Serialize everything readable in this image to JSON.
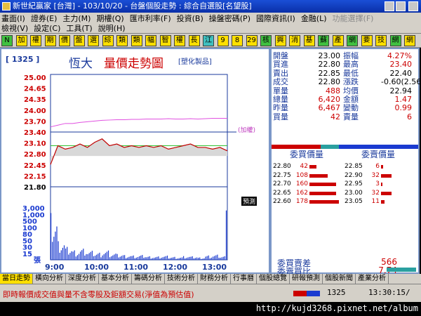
{
  "titlebar": {
    "text": "新世紀贏家 [台灣] - 103/10/20 - 台盤個股走勢 : 綜合自選股[名望股]"
  },
  "menu": {
    "row1": [
      "畫面(I)",
      "證券(E)",
      "主力(M)",
      "期權(Q)",
      "匯市利率(F)",
      "投資(B)",
      "操盤密碼(P)",
      "國際資訊(I)",
      "金融(L)",
      "功能選擇(F)"
    ],
    "row1_dim": [
      "功能選擇(F)"
    ],
    "row2": [
      "檢視(V)",
      "設定(C)",
      "工具(T)",
      "說明(H)"
    ]
  },
  "toolbar": {
    "buttons": [
      "N",
      "加",
      "權",
      "期",
      "價",
      "盤",
      "選",
      "綜",
      "類",
      "類",
      "幅",
      "智",
      "權",
      "長",
      "江",
      "9",
      "8",
      "29",
      "核",
      "興",
      "消",
      "基",
      "蘇",
      "產",
      "網",
      "要",
      "技",
      "網",
      "網"
    ]
  },
  "chart": {
    "code": "[ 1325 ]",
    "stock_name": "恆大",
    "title": "量價走勢圖",
    "industry": "[塑化製品]",
    "limit_up_note": "(加權)",
    "limit_down_note": "預測",
    "price_ticks": [
      "25.00",
      "24.65",
      "24.35",
      "24.00",
      "23.70",
      "23.40",
      "23.10",
      "22.80",
      "22.45",
      "22.15",
      "21.80"
    ],
    "volume_ticks": [
      "3,000",
      "1,000",
      "500",
      "100",
      "80",
      "50",
      "30",
      "15",
      "張"
    ],
    "time_ticks": [
      "9:00",
      "10:00",
      "11:00",
      "12:00",
      "13:00"
    ]
  },
  "chart_data": {
    "type": "line",
    "x": [
      "9:00",
      "9:05",
      "9:10",
      "9:15",
      "9:20",
      "9:25",
      "9:30",
      "9:40",
      "9:50",
      "10:00",
      "10:15",
      "10:30",
      "10:45",
      "11:00",
      "11:15",
      "11:30",
      "11:45",
      "12:00",
      "12:15",
      "12:30",
      "12:45",
      "13:00",
      "13:10",
      "13:20",
      "13:30"
    ],
    "series": [
      {
        "values": [
          22.45,
          23.0,
          22.9,
          22.95,
          23.05,
          22.95,
          23.1,
          23.2,
          23.0,
          23.05,
          22.95,
          23.0,
          22.95,
          23.0,
          22.95,
          23.0,
          22.9,
          22.95,
          23.0,
          23.05,
          22.95,
          22.95,
          22.9,
          22.95,
          22.85
        ]
      },
      {
        "values": [
          23.55,
          23.6,
          23.65,
          23.65,
          23.68,
          23.7,
          23.72,
          23.74,
          23.75,
          23.76,
          23.76,
          23.77,
          23.77,
          23.78,
          23.78,
          23.78,
          23.79,
          23.78,
          23.78,
          23.79,
          23.78,
          23.79,
          23.8,
          23.8,
          23.8
        ]
      }
    ],
    "ylim": [
      21.8,
      25.0
    ],
    "reference_price": 23.4,
    "volume": [
      620,
      300,
      200,
      160,
      180,
      140,
      120,
      150,
      110,
      90,
      80,
      70,
      75,
      60,
      55,
      65,
      50,
      45,
      60,
      55,
      40,
      70,
      80,
      60,
      900
    ]
  },
  "quote": {
    "left": [
      {
        "label": "開盤",
        "value": "23.00",
        "color": "#000"
      },
      {
        "label": "買進",
        "value": "22.80",
        "color": "#000"
      },
      {
        "label": "賣出",
        "value": "22.85",
        "color": "#000"
      },
      {
        "label": "成交",
        "value": "22.80",
        "color": "#000"
      },
      {
        "label": "單量",
        "value": "488",
        "color": "#c00"
      },
      {
        "label": "總量",
        "value": "6,420",
        "color": "#c00"
      },
      {
        "label": "昨量",
        "value": "6,467",
        "color": "#c00"
      },
      {
        "label": "買量",
        "value": "42",
        "color": "#c00"
      }
    ],
    "right": [
      {
        "label": "振幅",
        "value": "4.27%",
        "color": "#c00"
      },
      {
        "label": "最高",
        "value": "23.40",
        "color": "#c00"
      },
      {
        "label": "最低",
        "value": "22.40",
        "color": "#000"
      },
      {
        "label": "漲跌",
        "value": "-0.60(2.56)",
        "color": "#000"
      },
      {
        "label": "均價",
        "value": "22.94",
        "color": "#000"
      },
      {
        "label": "金額",
        "value": "1.47",
        "color": "#c00"
      },
      {
        "label": "變動",
        "value": "0.99",
        "color": "#c00"
      },
      {
        "label": "賣量",
        "value": "6",
        "color": "#c00"
      }
    ],
    "bid_title": "委買價量",
    "ask_title": "委賣價量",
    "bids": [
      {
        "price": "22.80",
        "vol": "42",
        "level": 0.22
      },
      {
        "price": "22.75",
        "vol": "108",
        "level": 0.58
      },
      {
        "price": "22.70",
        "vol": "160",
        "level": 0.86
      },
      {
        "price": "22.65",
        "vol": "162",
        "level": 0.87
      },
      {
        "price": "22.60",
        "vol": "178",
        "level": 0.95
      }
    ],
    "asks": [
      {
        "price": "22.85",
        "vol": "6",
        "level": 0.06
      },
      {
        "price": "22.90",
        "vol": "32",
        "level": 0.33
      },
      {
        "price": "22.95",
        "vol": "3",
        "level": 0.04
      },
      {
        "price": "23.00",
        "vol": "32",
        "level": 0.33
      },
      {
        "price": "23.05",
        "vol": "11",
        "level": 0.12
      }
    ],
    "bidask_diff_label": "委買賣差",
    "bidask_diff": "566",
    "bidask_ratio_label": "委賣買比",
    "bidask_ratio": "7.74"
  },
  "tabs": [
    "當日走勢",
    "橫向分析",
    "深度分析",
    "基本分析",
    "籌碼分析",
    "技術分析",
    "財務分析",
    "行事曆",
    "個股總覽",
    "研報預測",
    "個股新聞",
    "產業分析"
  ],
  "active_tab": 0,
  "status": {
    "ticker": "即時報價成交值與量不含零股及鉅額交易(淨值為預估值)",
    "code": "1325",
    "time": "13:30:15/"
  },
  "url": "http://kujd3268.pixnet.net/album",
  "colors": {
    "price_line": "#c00000",
    "avg_line": "#e050e0",
    "ref_line": "#1a3a9c",
    "volume_bar": "#1a3ad0",
    "panel_border": "#7b97c8"
  }
}
